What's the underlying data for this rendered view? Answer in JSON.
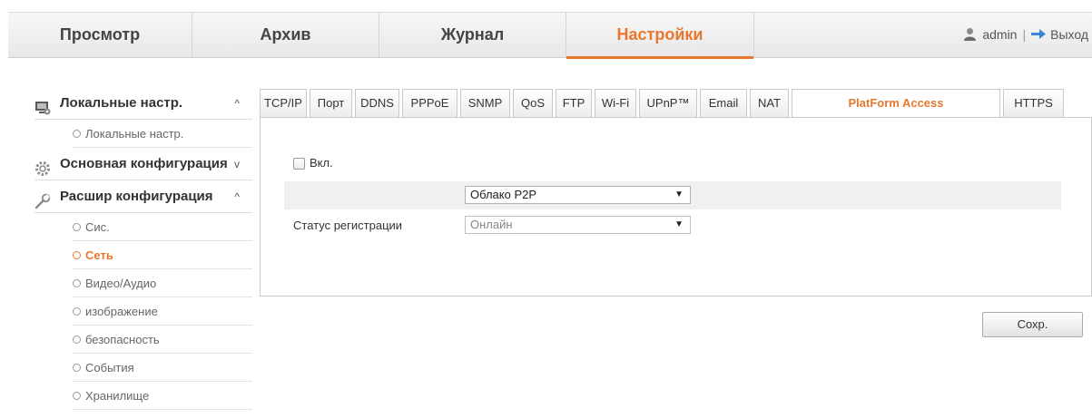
{
  "topnav": {
    "tabs": [
      {
        "label": "Просмотр"
      },
      {
        "label": "Архив"
      },
      {
        "label": "Журнал"
      },
      {
        "label": "Настройки",
        "active": true
      }
    ],
    "user": "admin",
    "separator": "|",
    "logout": "Выход"
  },
  "sidebar": {
    "local": {
      "label": "Локальные настр.",
      "chevron": "^",
      "items": [
        "Локальные настр."
      ]
    },
    "basic": {
      "label": "Основная конфигурация",
      "chevron": "v"
    },
    "advanced": {
      "label": "Расшир конфигурация",
      "chevron": "^",
      "items": [
        "Сис.",
        "Сеть",
        "Видео/Аудио",
        "изображение",
        "безопасность",
        "События",
        "Хранилище"
      ],
      "active_item": "Сеть"
    }
  },
  "tabs": [
    "TCP/IP",
    "Порт",
    "DDNS",
    "PPPoE",
    "SNMP",
    "QoS",
    "FTP",
    "Wi-Fi",
    "UPnP™",
    "Email",
    "NAT",
    "PlatForm Access",
    "HTTPS"
  ],
  "active_tab": "PlatForm Access",
  "form": {
    "enable_label": "Вкл.",
    "enable_checked": false,
    "platform_value": "Облако P2P",
    "status_label": "Статус регистрации",
    "status_value": "Онлайн"
  },
  "save_label": "Сохр.",
  "colors": {
    "accent": "#e8772e",
    "row_bg": "#f0f0f0",
    "border": "#c9c9c9"
  }
}
